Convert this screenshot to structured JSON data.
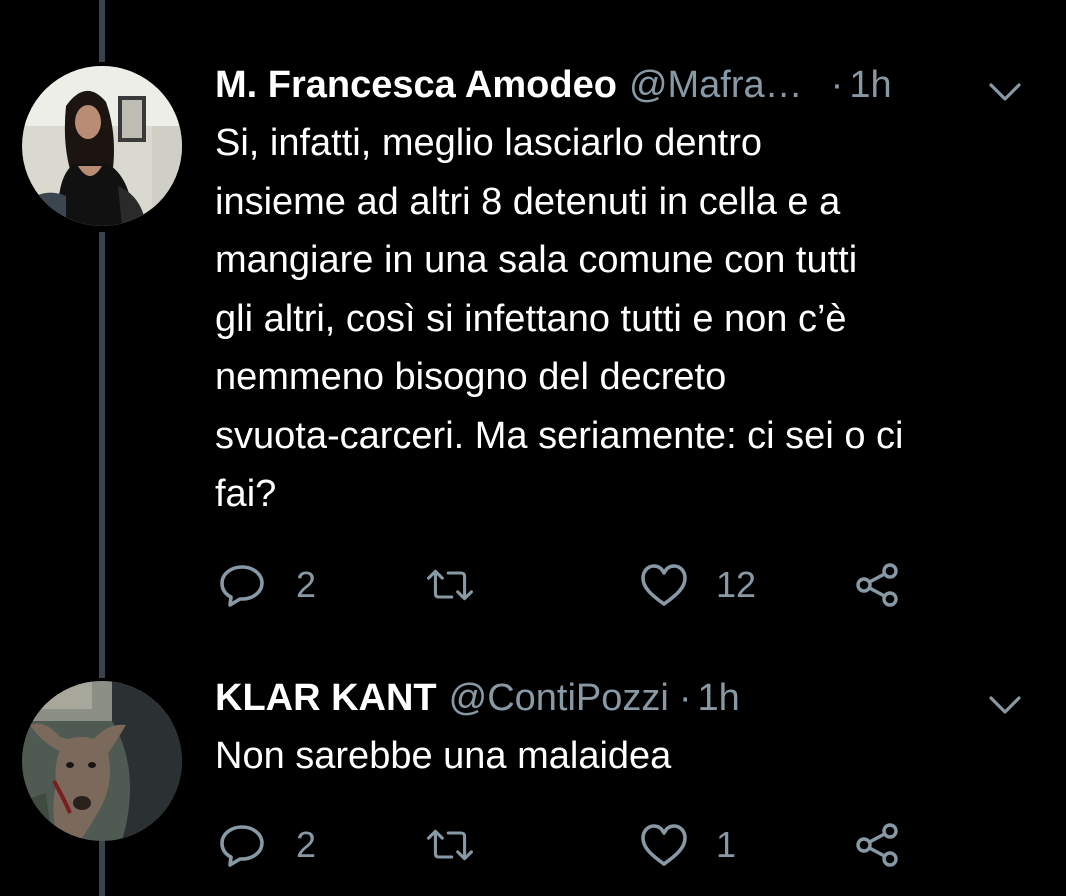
{
  "colors": {
    "background": "#000000",
    "text_primary": "#ffffff",
    "text_secondary": "#8899a6",
    "thread_line": "#38444d"
  },
  "tweets": [
    {
      "display_name": "M. Francesca Amodeo",
      "handle": "@Mafra…",
      "separator": "·",
      "time": "1h",
      "text": "Si, infatti, meglio lasciarlo dentro\ninsieme ad altri 8 detenuti in cella e a\nmangiare in una sala comune con tutti\ngli altri, così si infettano tutti e non c’è\nnemmeno bisogno del decreto\nsvuota-carceri. Ma seriamente: ci sei o ci\nfai?",
      "reply_count": "2",
      "like_count": "12",
      "icons": [
        "avatar",
        "chevron-down-icon",
        "reply-icon",
        "retweet-icon",
        "like-icon",
        "share-icon"
      ]
    },
    {
      "display_name": "KLAR KANT",
      "handle": "@ContiPozzi",
      "separator": "·",
      "time": "1h",
      "text": "Non sarebbe una malaidea",
      "reply_count": "2",
      "like_count": "1",
      "icons": [
        "avatar",
        "chevron-down-icon",
        "reply-icon",
        "retweet-icon",
        "like-icon",
        "share-icon"
      ]
    }
  ]
}
